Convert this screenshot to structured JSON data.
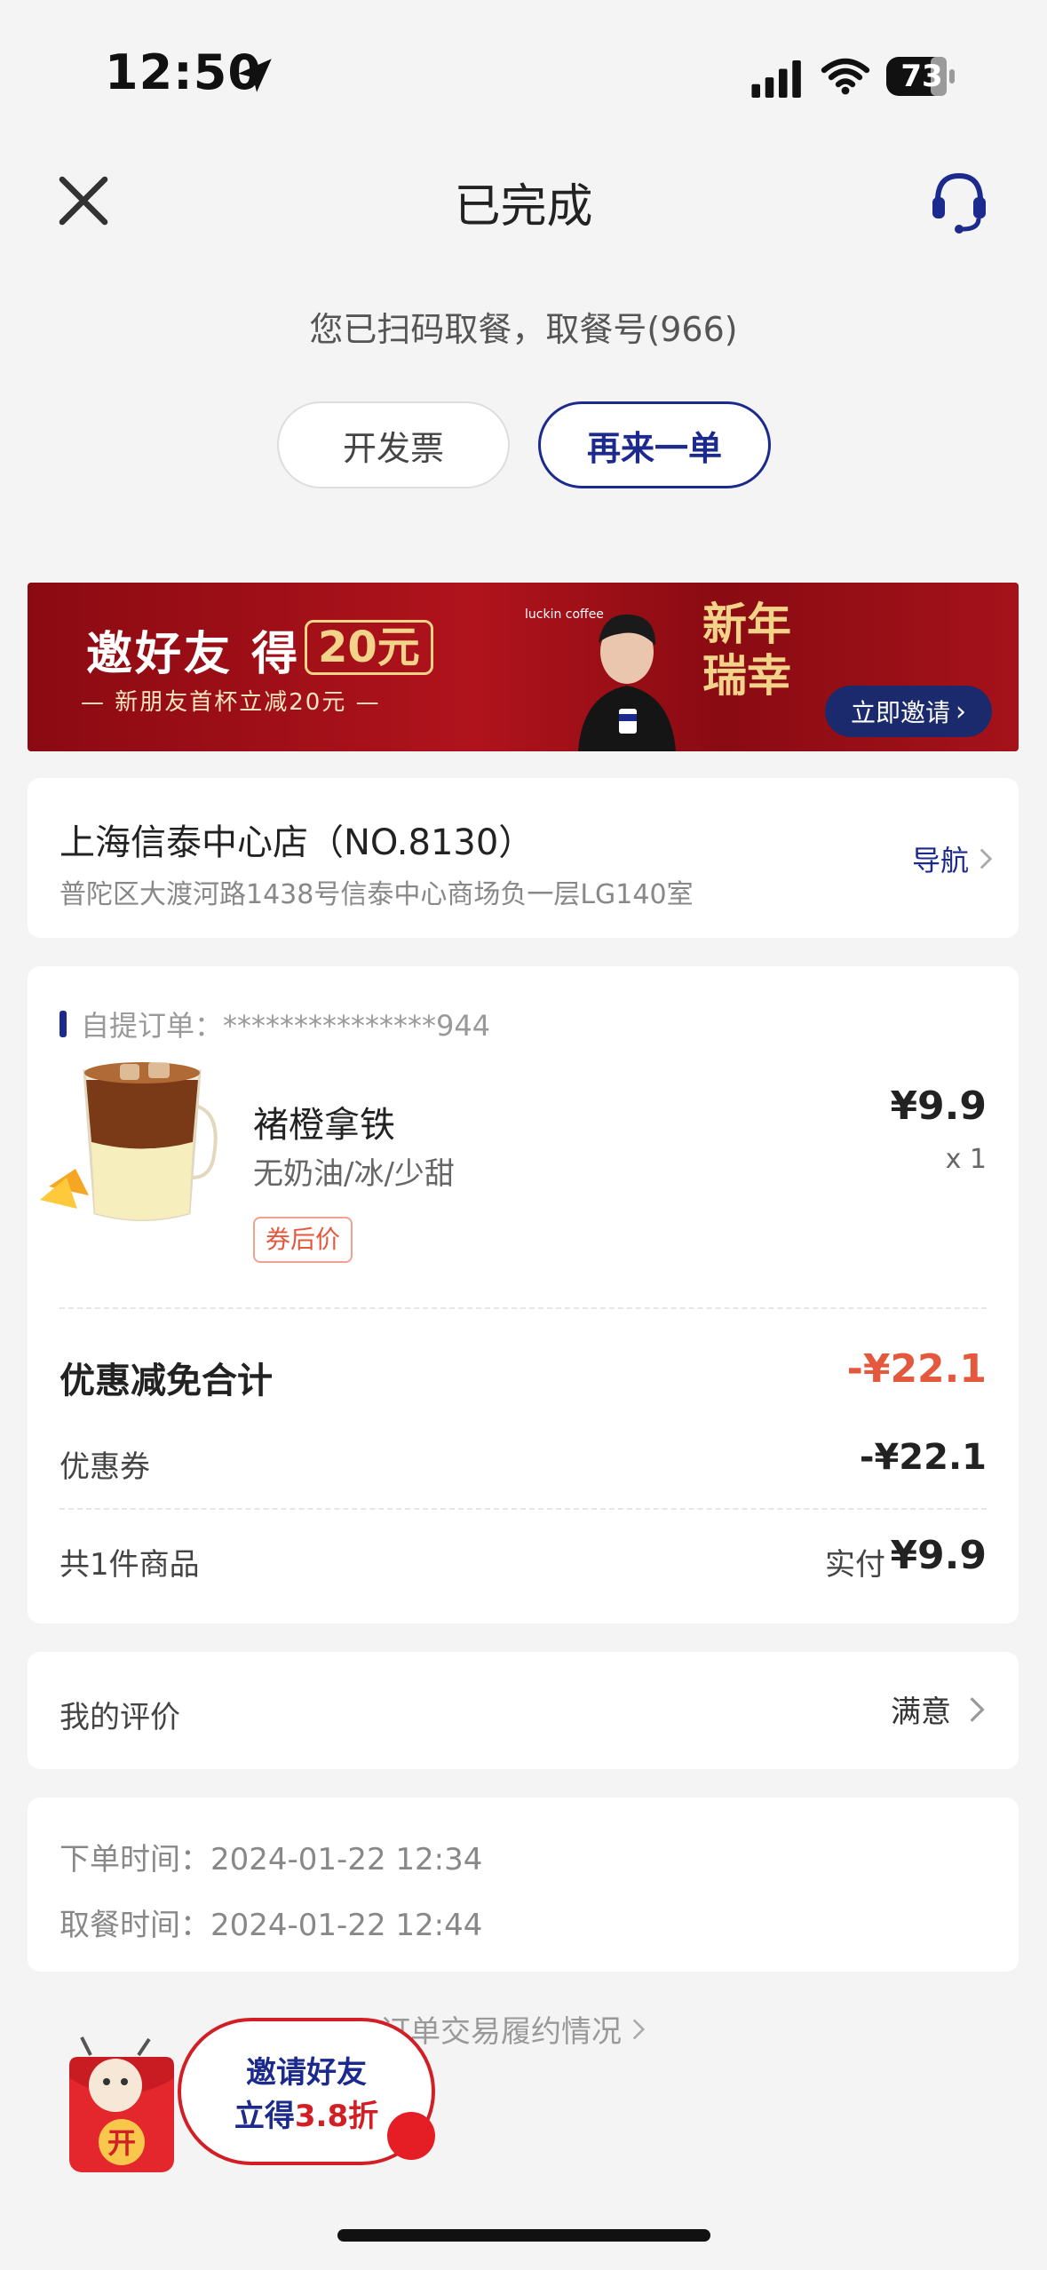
{
  "status_bar": {
    "time": "12:50",
    "battery": "73"
  },
  "header": {
    "title": "已完成"
  },
  "pickup": {
    "info": "您已扫码取餐，取餐号(966)"
  },
  "actions": {
    "invoice_label": "开发票",
    "reorder_label": "再来一单"
  },
  "banner": {
    "headline": "邀好友 得",
    "amount": "20元",
    "subline": "— 新朋友首杯立减20元 —",
    "brand": "luckin coffee",
    "festival": "新年瑞幸",
    "invite_button": "立即邀请"
  },
  "store": {
    "name": "上海信泰中心店（NO.8130）",
    "address": "普陀区大渡河路1438号信泰中心商场负一层LG140室",
    "nav_label": "导航"
  },
  "order": {
    "label": "自提订单：",
    "number": "***************944",
    "product": {
      "name": "褚橙拿铁",
      "spec": "无奶油/冰/少甜",
      "tag": "券后价",
      "price": "¥9.9",
      "qty": "x 1"
    },
    "discount_label": "优惠减免合计",
    "discount_value": "-¥22.1",
    "coupon_label": "优惠券",
    "coupon_value": "-¥22.1",
    "count_label": "共1件商品",
    "paid_label": "实付",
    "paid_value": "¥9.9"
  },
  "review": {
    "label": "我的评价",
    "value": "满意"
  },
  "times": {
    "order_time": "下单时间：2024-01-22 12:34",
    "pickup_time": "取餐时间：2024-01-22 12:44"
  },
  "fulfillment": {
    "label": "订单交易履约情况"
  },
  "float_invite": {
    "line1": "邀请好友",
    "line2_prefix": "立得",
    "line2_highlight": "3.8折",
    "packet_char": "开"
  },
  "colors": {
    "brand_blue": "#1b2a8c",
    "accent_red": "#e4583e",
    "banner_red": "#a5121a"
  }
}
